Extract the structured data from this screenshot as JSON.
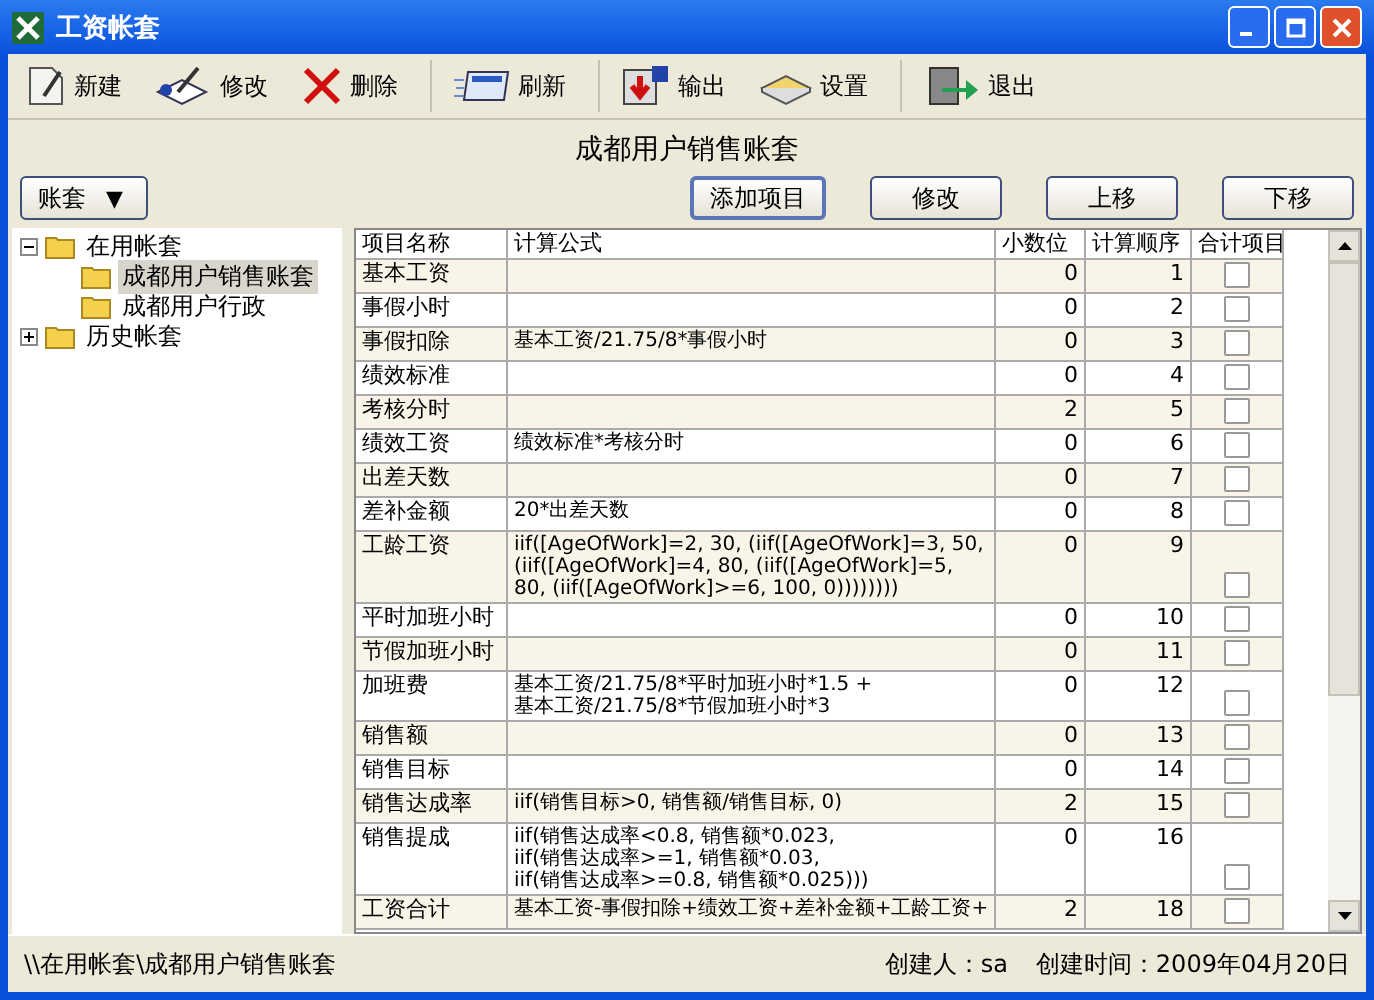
{
  "window": {
    "title": "工资帐套"
  },
  "toolbar": [
    {
      "kind": "new",
      "label": "新建"
    },
    {
      "kind": "edit",
      "label": "修改"
    },
    {
      "kind": "delete",
      "label": "删除"
    },
    {
      "kind": "refresh",
      "label": "刷新",
      "sep_before": true
    },
    {
      "kind": "export",
      "label": "输出",
      "sep_before": true
    },
    {
      "kind": "settings",
      "label": "设置"
    },
    {
      "kind": "exit",
      "label": "退出",
      "sep_before": true
    }
  ],
  "heading": "成都用户销售账套",
  "dropdown": {
    "label": "账套",
    "caret": "▼"
  },
  "actions": [
    "添加项目",
    "修改",
    "上移",
    "下移"
  ],
  "tree": [
    {
      "label": "在用帐套",
      "expanded": true,
      "selected": false,
      "children": [
        {
          "label": "成都用户销售账套",
          "selected": true
        },
        {
          "label": "成都用户行政",
          "selected": false
        }
      ]
    },
    {
      "label": "历史帐套",
      "expanded": false,
      "selected": false
    }
  ],
  "table": {
    "columns": [
      "项目名称",
      "计算公式",
      "小数位",
      "计算顺序",
      "合计项目"
    ],
    "rows": [
      {
        "name": "基本工资",
        "formula": [],
        "decimals": "0",
        "order": "1",
        "checked": false
      },
      {
        "name": "事假小时",
        "formula": [],
        "decimals": "0",
        "order": "2",
        "checked": false
      },
      {
        "name": "事假扣除",
        "formula": [
          "基本工资/21.75/8*事假小时"
        ],
        "decimals": "0",
        "order": "3",
        "checked": false
      },
      {
        "name": "绩效标准",
        "formula": [],
        "decimals": "0",
        "order": "4",
        "checked": false
      },
      {
        "name": "考核分时",
        "formula": [],
        "decimals": "2",
        "order": "5",
        "checked": false
      },
      {
        "name": "绩效工资",
        "formula": [
          "绩效标准*考核分时"
        ],
        "decimals": "0",
        "order": "6",
        "checked": false
      },
      {
        "name": "出差天数",
        "formula": [],
        "decimals": "0",
        "order": "7",
        "checked": false
      },
      {
        "name": "差补金额",
        "formula": [
          "20*出差天数"
        ],
        "decimals": "0",
        "order": "8",
        "checked": false
      },
      {
        "name": "工龄工资",
        "formula": [
          "iif([AgeOfWork]=2, 30, (iif([AgeOfWork]=3, 50,",
          "(iif([AgeOfWork]=4, 80, (iif([AgeOfWork]=5,",
          "80, (iif([AgeOfWork]>=6, 100, 0))))))))"
        ],
        "decimals": "0",
        "order": "9",
        "checked": false
      },
      {
        "name": "平时加班小时",
        "formula": [],
        "decimals": "0",
        "order": "10",
        "checked": false
      },
      {
        "name": "节假加班小时",
        "formula": [],
        "decimals": "0",
        "order": "11",
        "checked": false
      },
      {
        "name": "加班费",
        "formula": [
          "基本工资/21.75/8*平时加班小时*1.5 +",
          "基本工资/21.75/8*节假加班小时*3"
        ],
        "decimals": "0",
        "order": "12",
        "checked": false
      },
      {
        "name": "销售额",
        "formula": [],
        "decimals": "0",
        "order": "13",
        "checked": false
      },
      {
        "name": "销售目标",
        "formula": [],
        "decimals": "0",
        "order": "14",
        "checked": false
      },
      {
        "name": "销售达成率",
        "formula": [
          "iif(销售目标>0, 销售额/销售目标, 0)"
        ],
        "decimals": "2",
        "order": "15",
        "checked": false
      },
      {
        "name": "销售提成",
        "formula": [
          "iif(销售达成率<0.8, 销售额*0.023,",
          "iif(销售达成率>=1, 销售额*0.03,",
          "iif(销售达成率>=0.8, 销售额*0.025)))"
        ],
        "decimals": "0",
        "order": "16",
        "checked": false
      },
      {
        "name": "工资合计",
        "formula": [
          "基本工资-事假扣除+绩效工资+差补金额+工龄工资+"
        ],
        "decimals": "2",
        "order": "18",
        "checked": false
      }
    ]
  },
  "status_bar": {
    "path": "\\\\在用帐套\\成都用户销售账套",
    "creator": "创建人：sa",
    "created": "创建时间：2009年04月20日"
  }
}
